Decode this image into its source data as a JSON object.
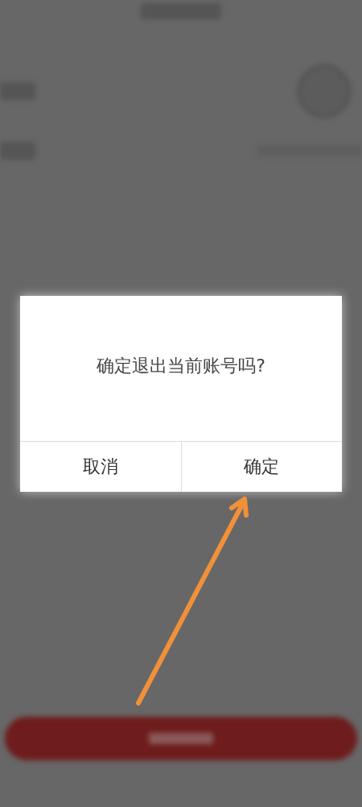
{
  "dialog": {
    "message": "确定退出当前账号吗?",
    "buttons": [
      {
        "label": "取消"
      },
      {
        "label": "确定"
      }
    ]
  }
}
